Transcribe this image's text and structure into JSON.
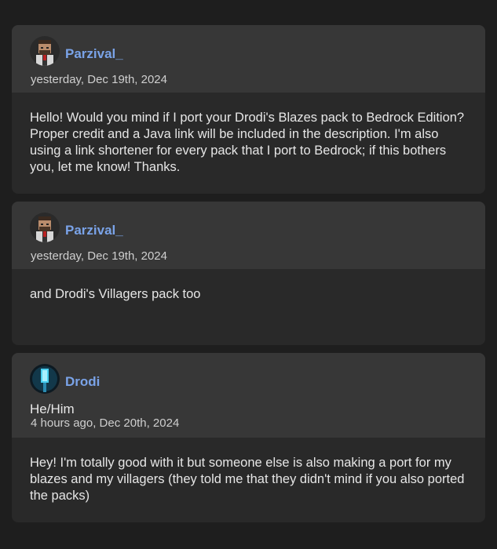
{
  "comments": [
    {
      "username": "Parzival_",
      "date": "yesterday, Dec 19th, 2024",
      "text": "Hello! Would you mind if I port your Drodi's Blazes pack to Bedrock Edition? Proper credit and a Java link will be included in the description. I'm also using a link shortener for every pack that I port to Bedrock; if this bothers you, let me know! Thanks."
    },
    {
      "username": "Parzival_",
      "date": "yesterday, Dec 19th, 2024",
      "text": "and Drodi's Villagers pack too"
    },
    {
      "username": "Drodi",
      "pronouns": "He/Him",
      "date": "4 hours ago, Dec 20th, 2024",
      "text": "Hey! I'm totally good with it but someone else is also making a port for my blazes and my villagers (they told me that they didn't mind if you also ported the packs)"
    }
  ],
  "colors": {
    "background": "#1e1e1e",
    "card_header": "#373737",
    "card_body": "#292929",
    "username": "#7aa3e8"
  },
  "icons": {
    "parzival_avatar": "pixel-character-avatar",
    "drodi_avatar": "blue-crystal-avatar"
  }
}
